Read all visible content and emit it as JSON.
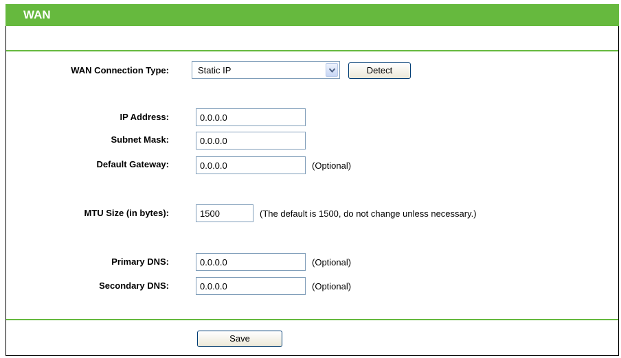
{
  "header": {
    "title": "WAN"
  },
  "form": {
    "connection_type": {
      "label": "WAN Connection Type:",
      "selected": "Static IP",
      "detect_label": "Detect"
    },
    "ip_address": {
      "label": "IP Address:",
      "value": "0.0.0.0"
    },
    "subnet_mask": {
      "label": "Subnet Mask:",
      "value": "0.0.0.0"
    },
    "default_gateway": {
      "label": "Default Gateway:",
      "value": "0.0.0.0",
      "note": "(Optional)"
    },
    "mtu": {
      "label": "MTU Size (in bytes):",
      "value": "1500",
      "note": "(The default is 1500, do not change unless necessary.)"
    },
    "primary_dns": {
      "label": "Primary DNS:",
      "value": "0.0.0.0",
      "note": "(Optional)"
    },
    "secondary_dns": {
      "label": "Secondary DNS:",
      "value": "0.0.0.0",
      "note": "(Optional)"
    }
  },
  "footer": {
    "save_label": "Save"
  },
  "colors": {
    "accent": "#66b93e",
    "input_border": "#7f9db9"
  },
  "icons": {
    "dropdown": "chevron-down-icon"
  }
}
